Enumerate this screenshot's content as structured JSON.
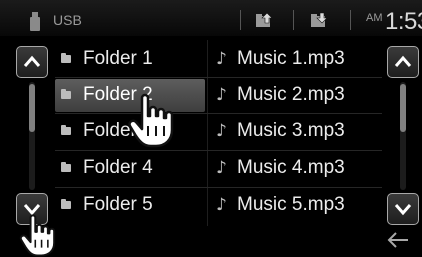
{
  "status": {
    "source_label": "USB",
    "am_label": "AM",
    "clock": "1:53"
  },
  "folders": [
    {
      "label": "Folder 1"
    },
    {
      "label": "Folder 2"
    },
    {
      "label": "Folder 3"
    },
    {
      "label": "Folder 4"
    },
    {
      "label": "Folder 5"
    }
  ],
  "tracks": [
    {
      "label": "Music 1.mp3"
    },
    {
      "label": "Music 2.mp3"
    },
    {
      "label": "Music 3.mp3"
    },
    {
      "label": "Music 4.mp3"
    },
    {
      "label": "Music 5.mp3"
    }
  ],
  "selected_folder": "Folder 2",
  "icons": {
    "source": "usb-stick-icon",
    "folder_up": "folder-up-icon",
    "folder_down": "folder-down-icon",
    "scroll_up": "chevron-up-icon",
    "scroll_down": "chevron-down-icon",
    "folder": "folder-icon",
    "track": "music-note-icon",
    "back": "back-arrow-icon"
  },
  "colors": {
    "background": "#000000",
    "selected_row": "#505050",
    "text": "#ececec"
  }
}
